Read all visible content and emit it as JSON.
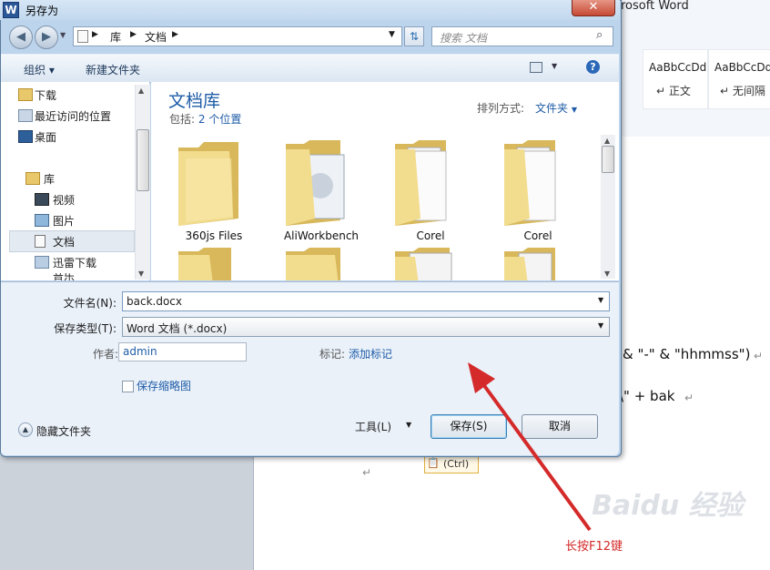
{
  "word": {
    "title": "rosoft Word",
    "styles": [
      {
        "sample": "AaBbCcDd",
        "name": "↵ 正文"
      },
      {
        "sample": "AaBbCcDd",
        "name": "↵ 无间隔"
      }
    ],
    "doc_lines": [
      "& \"-\" & \"hhmmss\")",
      "\\\" + bak"
    ],
    "paste_option": "(Ctrl)"
  },
  "dialog": {
    "title": "另存为",
    "close_label": "✕",
    "address": {
      "segments": [
        "库",
        "文档"
      ]
    },
    "search_placeholder": "搜索 文档",
    "toolbar": {
      "organize": "组织 ▾",
      "new_folder": "新建文件夹"
    },
    "nav": {
      "items": [
        {
          "label": "下载"
        },
        {
          "label": "最近访问的位置"
        },
        {
          "label": "桌面"
        },
        {
          "label": "库"
        },
        {
          "label": "视频"
        },
        {
          "label": "图片"
        },
        {
          "label": "文档"
        },
        {
          "label": "迅雷下载"
        },
        {
          "label": "音乐"
        }
      ]
    },
    "library": {
      "title": "文档库",
      "includes_label": "包括:",
      "includes_value": "2 个位置",
      "sort_label": "排列方式:",
      "sort_value": "文件夹"
    },
    "folders": [
      {
        "label": "360js Files"
      },
      {
        "label": "AliWorkbench"
      },
      {
        "label": "Corel"
      },
      {
        "label": "Corel"
      }
    ],
    "form": {
      "filename_label": "文件名(N):",
      "filename_value": "back.docx",
      "filetype_label": "保存类型(T):",
      "filetype_value": "Word 文档 (*.docx)",
      "author_label": "作者:",
      "author_value": "admin",
      "tags_label": "标记:",
      "tags_value": "添加标记",
      "thumbnail_label": "保存缩略图"
    },
    "footer": {
      "hide_folders": "隐藏文件夹",
      "tools": "工具(L)",
      "save": "保存(S)",
      "cancel": "取消"
    }
  },
  "annotation": {
    "text": "长按F12键",
    "color": "#d42a2a"
  },
  "watermark": "Baidu 经验",
  "colors": {
    "accent": "#1e5ca7",
    "annotation_red": "#d42a2a"
  }
}
